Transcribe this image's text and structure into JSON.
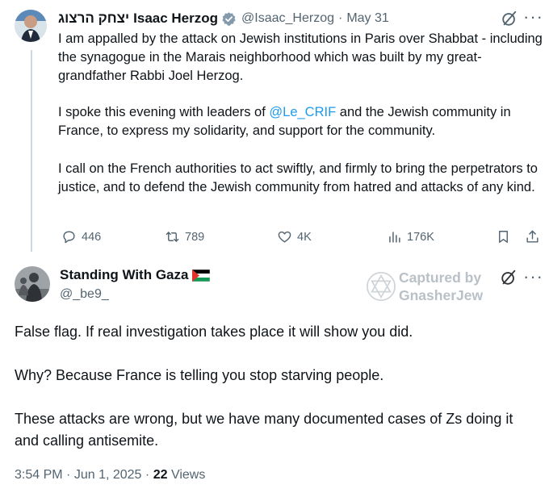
{
  "tweet1": {
    "name_hebrew": "יצחק הרצוג",
    "name": "Isaac Herzog",
    "handle": "@Isaac_Herzog",
    "date_sep": "·",
    "date": "May 31",
    "p1": "I am appalled by the attack on Jewish institutions in Paris over Shabbat - including the synagogue in the Marais neighborhood which was built by my great-grandfather Rabbi Joel Herzog.",
    "p2_before": "I spoke this evening with leaders of ",
    "p2_mention": "@Le_CRIF",
    "p2_after": " and the Jewish community in France, to express my solidarity, and support for the community.",
    "p3": "I call on the French authorities to act swiftly, and firmly to bring the perpetrators to justice, and to defend the Jewish community from hatred and attacks of any kind.",
    "replies": "446",
    "reposts": "789",
    "likes": "4K",
    "views": "176K",
    "more": "···"
  },
  "tweet2": {
    "name": "Standing With Gaza",
    "handle": "@_be9_",
    "line1": "False flag. If real investigation takes place it will show you did.",
    "line2": "Why? Because France is telling you stop starving people.",
    "line3": "These attacks are wrong, but we have many documented cases of Zs doing it and calling antisemite.",
    "time": "3:54 PM",
    "sep": "·",
    "date": "Jun 1, 2025",
    "sep2": "·",
    "views_count": "22",
    "views_label": "Views",
    "more": "···"
  },
  "watermark": {
    "line1": "Captured by",
    "line2": "GnasherJew"
  },
  "colors": {
    "verified": "#829aab",
    "accent": "#1d9bf0",
    "muted": "#536471",
    "thread_line": "#cfd9de"
  },
  "icons": [
    "verified-badge-icon",
    "grok-slash-icon",
    "more-icon",
    "reply-icon",
    "repost-icon",
    "like-icon",
    "views-icon",
    "bookmark-icon",
    "share-icon",
    "palestine-flag-icon",
    "star-of-david-icon"
  ]
}
